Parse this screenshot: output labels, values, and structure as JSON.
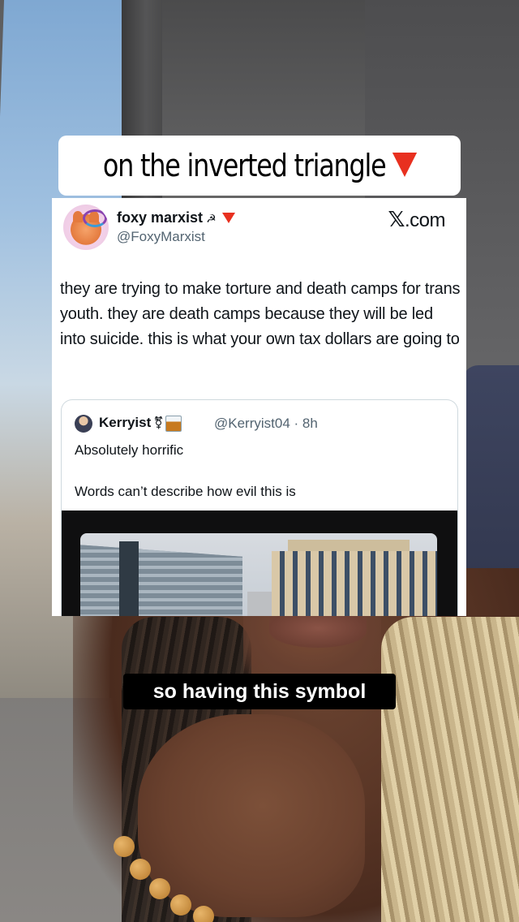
{
  "overlay_caption_top": {
    "text": "on the inverted triangle",
    "emoji": "red-triangle-pointed-down"
  },
  "tweet": {
    "author_name": "foxy marxist",
    "author_name_emoji": "☭",
    "author_name_icon": "red-triangle-pointed-down",
    "author_handle": "@FoxyMarxist",
    "brand_letter": "𝕏",
    "brand_suffix": ".com",
    "body": "they are trying to make torture and death camps for trans youth. they are death camps because they will be led into suicide. this is what your own tax dollars are going to",
    "quoted": {
      "author_name": "Kerryist",
      "author_name_emoji": "⚧",
      "author_name_icon": "whisky-glass-icon",
      "author_handle_time": "@Kerryist04 · 8h",
      "line1": "Absolutely horrific",
      "line2": "Words can’t describe how evil this is",
      "media": "building-photo"
    }
  },
  "overlay_caption_bottom": {
    "text": "so having this symbol"
  },
  "colors": {
    "caption_bg": "#ffffff",
    "caption_text": "#000000",
    "triangle": "#e8301f",
    "subtitle_bg": "#000000",
    "subtitle_text": "#ffffff",
    "handle_gray": "#536471"
  }
}
